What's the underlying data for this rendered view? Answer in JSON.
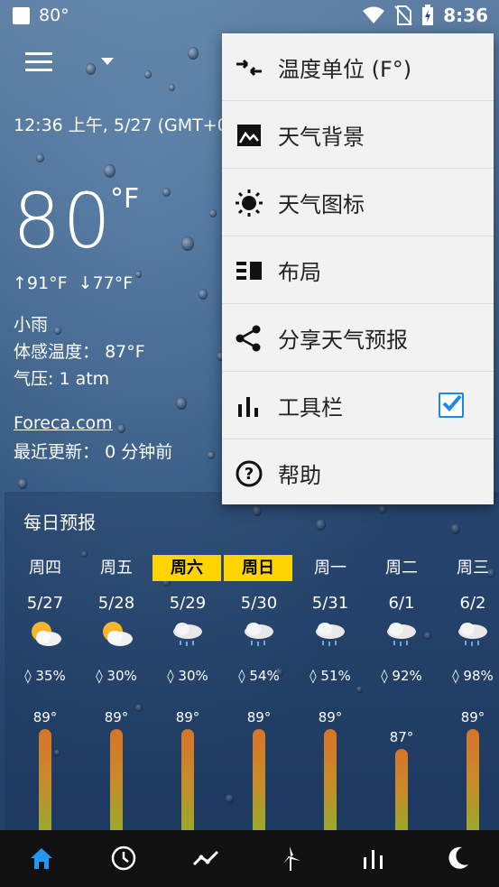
{
  "status_bar": {
    "temp": "80°",
    "time": "8:36"
  },
  "header": {
    "datetime": "12:36 上午, 5/27 (GMT+0"
  },
  "current": {
    "temp": "80",
    "unit": "°F",
    "high": "91°F",
    "low": "77°F",
    "condition": "小雨",
    "feels_like_label": "体感温度：",
    "feels_like": "87°F",
    "pressure_label": "气压:",
    "pressure": "1 atm",
    "source": "Foreca.com",
    "updated_label": "最近更新：",
    "updated": "0 分钟前"
  },
  "daily": {
    "title": "每日预报",
    "days": [
      {
        "name": "周四",
        "date": "5/27",
        "precip": "35%",
        "high": "89°",
        "icon": "partly-sunny-icon",
        "highlight": false
      },
      {
        "name": "周五",
        "date": "5/28",
        "precip": "30%",
        "high": "89°",
        "icon": "partly-sunny-icon",
        "highlight": false
      },
      {
        "name": "周六",
        "date": "5/29",
        "precip": "30%",
        "high": "89°",
        "icon": "cloud-rain-icon",
        "highlight": true
      },
      {
        "name": "周日",
        "date": "5/30",
        "precip": "54%",
        "high": "89°",
        "icon": "cloud-rain-icon",
        "highlight": true
      },
      {
        "name": "周一",
        "date": "5/31",
        "precip": "51%",
        "high": "89°",
        "icon": "cloud-rain-icon",
        "highlight": false
      },
      {
        "name": "周二",
        "date": "6/1",
        "precip": "92%",
        "high": "87°",
        "icon": "cloud-rain-icon",
        "highlight": false
      },
      {
        "name": "周三",
        "date": "6/2",
        "precip": "98%",
        "high": "89°",
        "icon": "cloud-rain-icon",
        "highlight": false
      }
    ]
  },
  "menu": {
    "items": [
      {
        "label": "温度单位 (F°)",
        "icon": "swap-arrows-icon"
      },
      {
        "label": "天气背景",
        "icon": "image-icon"
      },
      {
        "label": "天气图标",
        "icon": "sun-icon"
      },
      {
        "label": "布局",
        "icon": "layout-icon"
      },
      {
        "label": "分享天气预报",
        "icon": "share-icon"
      },
      {
        "label": "工具栏",
        "icon": "bar-chart-icon",
        "checked": true
      },
      {
        "label": "帮助",
        "icon": "help-icon"
      }
    ]
  },
  "nav": [
    "home-icon",
    "clock-icon",
    "trend-icon",
    "wind-turbine-icon",
    "bars-icon",
    "moon-icon"
  ],
  "colors": {
    "highlight": "#ffd400",
    "accent": "#1e88e5",
    "bar_top": "#d8742a",
    "bar_bottom": "#9aa82b"
  }
}
